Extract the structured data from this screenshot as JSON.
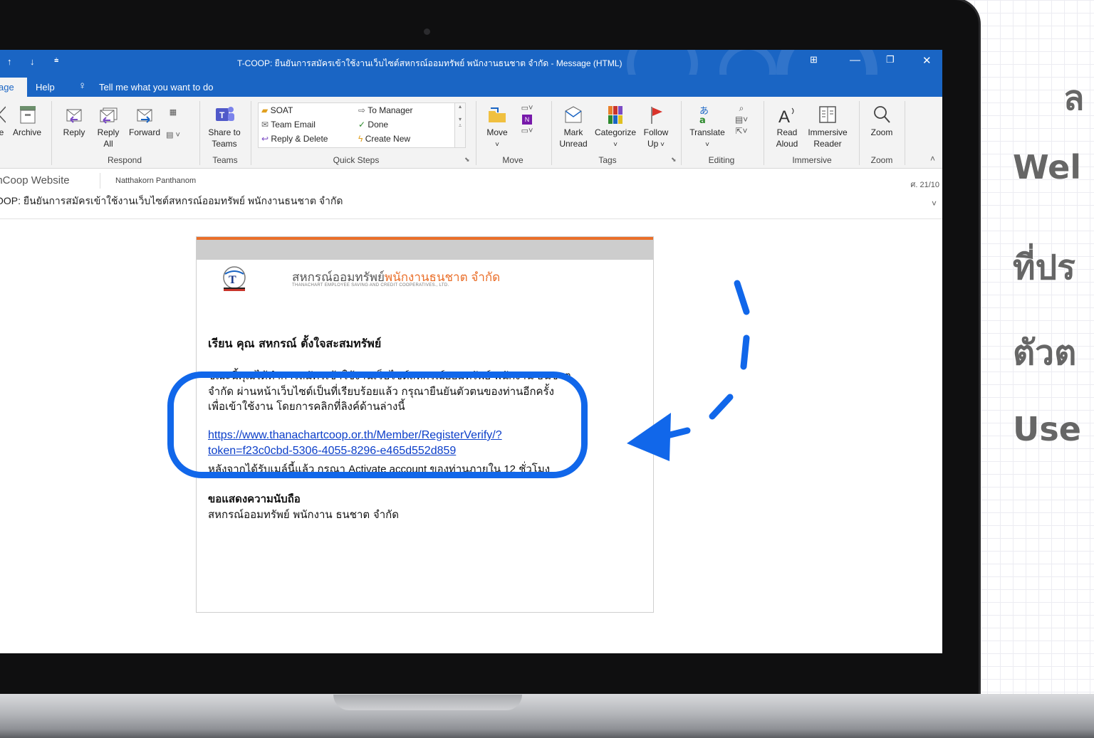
{
  "window": {
    "title": "T-COOP: ยืนยันการสมัครเข้าใช้งานเว็บไซต์สหกรณ์ออมทรัพย์ พนักงานธนชาต จำกัด - Message (HTML)"
  },
  "tabs": {
    "active": "age",
    "help": "Help",
    "tell_me": "Tell me what you want to do"
  },
  "ribbon": {
    "delete": {
      "archive_prefix": "e",
      "archive": "Archive"
    },
    "respond": {
      "reply": "Reply",
      "reply_all_1": "Reply",
      "reply_all_2": "All",
      "forward": "Forward",
      "group": "Respond"
    },
    "teams": {
      "share_1": "Share to",
      "share_2": "Teams",
      "group": "Teams"
    },
    "quick_steps": {
      "items": [
        "SOAT",
        "Team Email",
        "Reply & Delete",
        "To Manager",
        "Done",
        "Create New"
      ],
      "group": "Quick Steps"
    },
    "move": {
      "move": "Move",
      "group": "Move"
    },
    "tags": {
      "mark_unread_1": "Mark",
      "mark_unread_2": "Unread",
      "categorize": "Categorize",
      "follow_up_1": "Follow",
      "follow_up_2": "Up",
      "group": "Tags"
    },
    "editing": {
      "translate": "Translate",
      "group": "Editing"
    },
    "immersive": {
      "read_aloud_1": "Read",
      "read_aloud_2": "Aloud",
      "reader_1": "Immersive",
      "reader_2": "Reader",
      "group": "Immersive"
    },
    "zoom": {
      "zoom": "Zoom",
      "group": "Zoom"
    }
  },
  "message": {
    "from": "inCoop Website",
    "to": "Natthakorn Panthanom",
    "date": "ศ. 21/10",
    "subject": "OOP: ยืนยันการสมัครเข้าใช้งานเว็บไซต์สหกรณ์ออมทรัพย์ พนักงานธนชาต จำกัด"
  },
  "email": {
    "org_th_1": "สหกรณ์ออมทรัพย์",
    "org_th_2": "พนักงานธนชาต จำกัด",
    "org_en": "THANACHART EMPLOYEE SAVING AND CREDIT COOPERATIVES., LTD.",
    "salutation": "เรียน        คุณ สหกรณ์ ตั้งใจสะสมทรัพย์",
    "body_1": "ขณะนี้คุณได้ทำการสมัครเข้าใช้งานเว็บไซต์สหกรณ์ออมทรัพย์ พนักงาน ธนชาต",
    "body_2": "จำกัด ผ่านหน้าเว็บไซต์เป็นที่เรียบร้อยแล้ว กรุณายืนยันตัวตนของท่านอีกครั้ง",
    "body_3": "เพื่อเข้าใช้งาน โดยการคลิกที่ลิงค์ด้านล่างนี้",
    "link_1": "https://www.thanachartcoop.or.th/Member/RegisterVerify/?",
    "link_2": "token=f23c0cbd-5306-4055-8296-e465d552d859",
    "activate": "หลังจากได้รับเมล์นี้แล้ว กรุณา Activate account ของท่านภายใน 12 ชั่วโมง",
    "closing": "ขอแสดงความนับถือ",
    "signature": "สหกรณ์ออมทรัพย์ พนักงาน ธนชาต จำกัด"
  },
  "side_text": [
    "ล",
    "Wel",
    "ที่ปร",
    "ตัวต",
    "Use"
  ],
  "colors": {
    "outlook_blue": "#1a65c4",
    "accent_orange": "#ea6f2a",
    "highlight_blue": "#1167ea"
  }
}
